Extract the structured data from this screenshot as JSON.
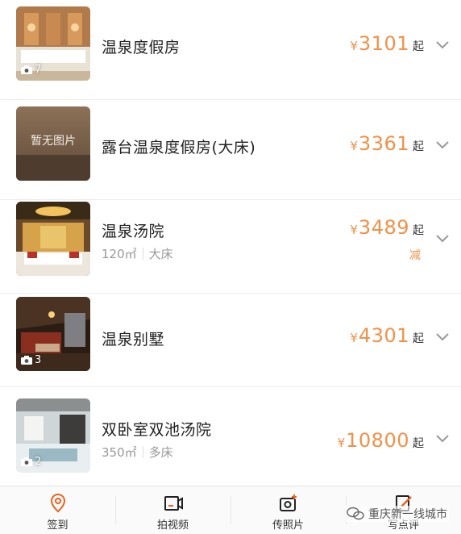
{
  "rooms": [
    {
      "name": "温泉度假房",
      "price": "3101",
      "currency": "¥",
      "suffix": "起",
      "photos": "7"
    },
    {
      "name": "露台温泉度假房(大床)",
      "price": "3361",
      "currency": "¥",
      "suffix": "起",
      "placeholder": "暂无图片"
    },
    {
      "name": "温泉汤院",
      "price": "3489",
      "currency": "¥",
      "suffix": "起",
      "area": "120㎡",
      "bed": "大床",
      "discount": "减"
    },
    {
      "name": "温泉别墅",
      "price": "4301",
      "currency": "¥",
      "suffix": "起",
      "photos": "3"
    },
    {
      "name": "双卧室双池汤院",
      "price": "10800",
      "currency": "¥",
      "suffix": "起",
      "area": "350㎡",
      "bed": "多床",
      "photos": "2"
    }
  ],
  "tabbar": [
    {
      "label": "签到",
      "icon": "location-pin-icon"
    },
    {
      "label": "拍视频",
      "icon": "video-icon"
    },
    {
      "label": "传照片",
      "icon": "camera-plus-icon"
    },
    {
      "label": "写点评",
      "icon": "edit-review-icon"
    }
  ],
  "watermark": {
    "text": "重庆新一线城市"
  },
  "colors": {
    "price": "#f19149",
    "accent": "#e8621f"
  }
}
